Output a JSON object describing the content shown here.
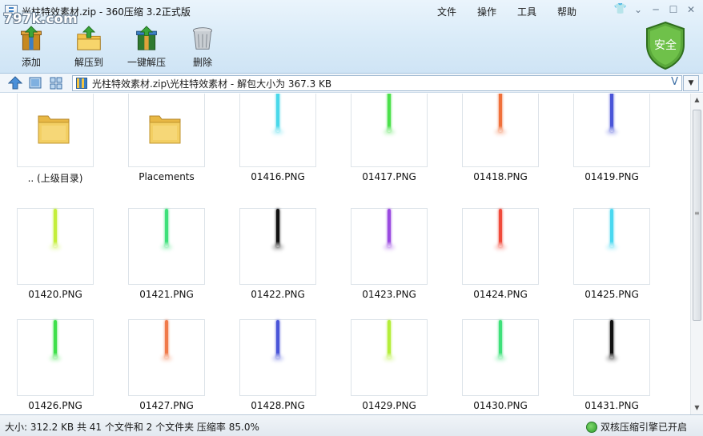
{
  "window": {
    "title": "光柱特效素材.zip - 360压缩 3.2正式版",
    "watermark": "797k.com",
    "menu": [
      "文件",
      "操作",
      "工具",
      "帮助"
    ]
  },
  "toolbar": {
    "add_label": "添加",
    "extract_label": "解压到",
    "oneclick_label": "一键解压",
    "delete_label": "删除",
    "safe_label": "安全"
  },
  "address": {
    "path": "光柱特效素材.zip\\光柱特效素材 - 解包大小为 367.3 KB",
    "end_mark": "V"
  },
  "files": [
    {
      "name": ".. (上级目录)",
      "kind": "folder"
    },
    {
      "name": "Placements",
      "kind": "folder"
    },
    {
      "name": "01416.PNG",
      "kind": "png",
      "color": "#4ad8ea"
    },
    {
      "name": "01417.PNG",
      "kind": "png",
      "color": "#4be04b"
    },
    {
      "name": "01418.PNG",
      "kind": "png",
      "color": "#f0703a"
    },
    {
      "name": "01419.PNG",
      "kind": "png",
      "color": "#4a55d8"
    },
    {
      "name": "01420.PNG",
      "kind": "png",
      "color": "#c4ee3a"
    },
    {
      "name": "01421.PNG",
      "kind": "png",
      "color": "#3ee07a"
    },
    {
      "name": "01422.PNG",
      "kind": "png",
      "color": "#111111"
    },
    {
      "name": "01423.PNG",
      "kind": "png",
      "color": "#9a4ae0"
    },
    {
      "name": "01424.PNG",
      "kind": "png",
      "color": "#f04a3a"
    },
    {
      "name": "01425.PNG",
      "kind": "png",
      "color": "#4ad8f0"
    },
    {
      "name": "01426.PNG",
      "kind": "png",
      "color": "#3ee04a"
    },
    {
      "name": "01427.PNG",
      "kind": "png",
      "color": "#f07a4a"
    },
    {
      "name": "01428.PNG",
      "kind": "png",
      "color": "#4a55d8"
    },
    {
      "name": "01429.PNG",
      "kind": "png",
      "color": "#b4ee3a"
    },
    {
      "name": "01430.PNG",
      "kind": "png",
      "color": "#3ee07a"
    },
    {
      "name": "01431.PNG",
      "kind": "png",
      "color": "#111111"
    }
  ],
  "status": {
    "summary": "大小: 312.2 KB 共 41 个文件和 2 个文件夹 压缩率 85.0%",
    "engine": "双核压缩引擎已开启"
  },
  "colors": {
    "folder": "#f3cf63",
    "accent": "#3b7fc4",
    "shield": "#5aa83a"
  }
}
